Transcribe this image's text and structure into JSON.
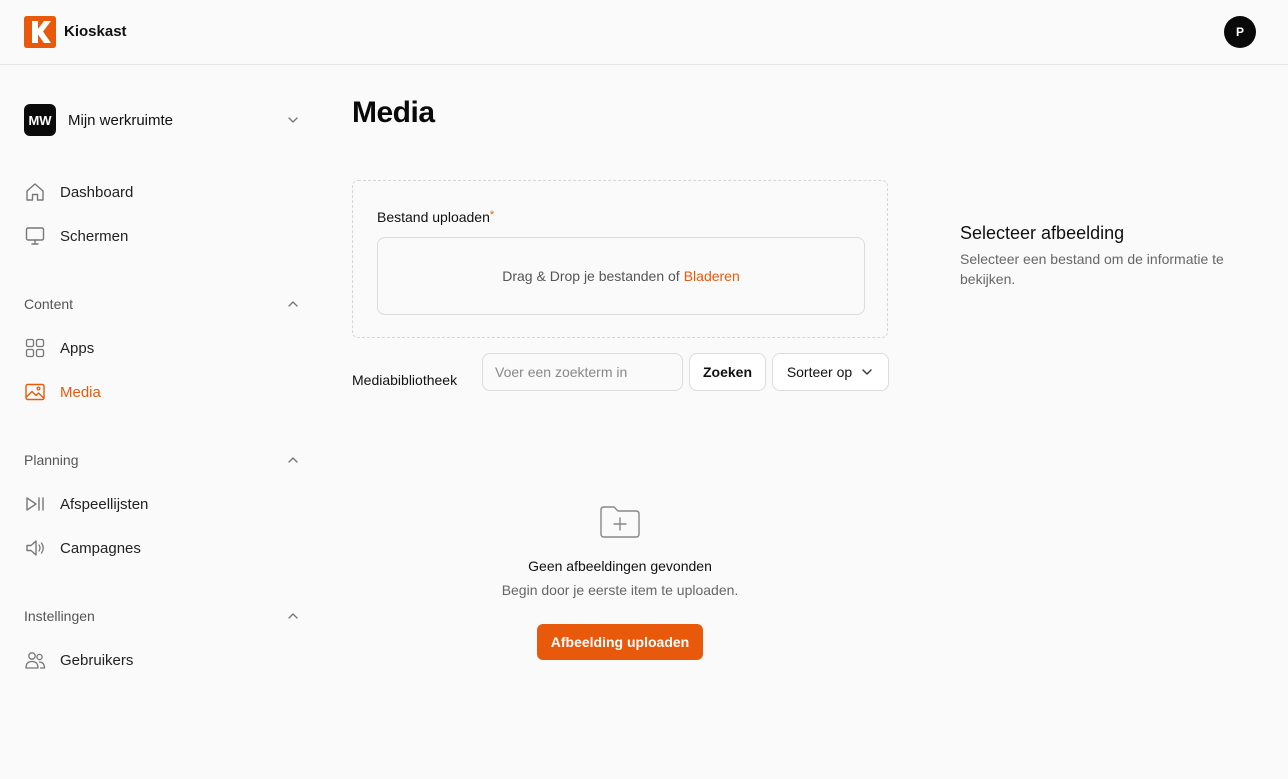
{
  "header": {
    "app_name": "Kioskast",
    "logo_letter": "K",
    "user_initial": "P",
    "brand_color": "#e8590c"
  },
  "sidebar": {
    "workspace": {
      "initials": "MW",
      "name": "Mijn werkruimte"
    },
    "top_items": [
      {
        "label": "Dashboard",
        "icon": "home-icon"
      },
      {
        "label": "Schermen",
        "icon": "monitor-icon"
      }
    ],
    "sections": [
      {
        "title": "Content",
        "items": [
          {
            "label": "Apps",
            "icon": "grid-icon"
          },
          {
            "label": "Media",
            "icon": "image-icon",
            "active": true
          }
        ]
      },
      {
        "title": "Planning",
        "items": [
          {
            "label": "Afspeellijsten",
            "icon": "play-pause-icon"
          },
          {
            "label": "Campagnes",
            "icon": "speaker-icon"
          }
        ]
      },
      {
        "title": "Instellingen",
        "items": [
          {
            "label": "Gebruikers",
            "icon": "users-icon"
          }
        ]
      }
    ]
  },
  "main": {
    "title": "Media",
    "upload": {
      "label": "Bestand uploaden",
      "required_mark": "*",
      "drop_text": "Drag & Drop je bestanden of",
      "browse_link": "Bladeren"
    },
    "library": {
      "label": "Mediabibliotheek",
      "search_placeholder": "Voer een zoekterm in",
      "search_button": "Zoeken",
      "sort_button": "Sorteer op"
    },
    "empty_state": {
      "title": "Geen afbeeldingen gevonden",
      "subtitle": "Begin door je eerste item te uploaden.",
      "button": "Afbeelding uploaden"
    }
  },
  "details": {
    "title": "Selecteer afbeelding",
    "subtitle": "Selecteer een bestand om de informatie te bekijken."
  }
}
